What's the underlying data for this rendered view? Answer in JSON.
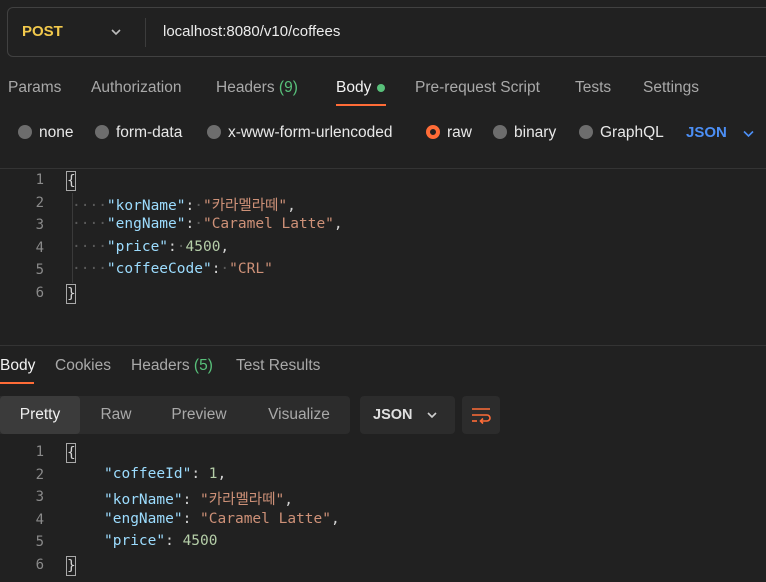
{
  "request": {
    "method": "POST",
    "url": "localhost:8080/v10/coffees"
  },
  "request_tabs": {
    "params": "Params",
    "authorization": "Authorization",
    "headers": "Headers",
    "headers_count": "(9)",
    "body": "Body",
    "pre_request_script": "Pre-request Script",
    "tests": "Tests",
    "settings": "Settings"
  },
  "body_types": {
    "none": "none",
    "form_data": "form-data",
    "x_www_form_urlencoded": "x-www-form-urlencoded",
    "raw": "raw",
    "binary": "binary",
    "graphql": "GraphQL",
    "selected": "raw",
    "format": "JSON"
  },
  "request_body": {
    "line_numbers": [
      "1",
      "2",
      "3",
      "4",
      "5",
      "6"
    ],
    "lines": [
      {
        "key": "\"korName\"",
        "value": "\"카라멜라떼\""
      },
      {
        "key": "\"engName\"",
        "value": "\"Caramel Latte\""
      },
      {
        "key": "\"price\"",
        "value": "4500"
      },
      {
        "key": "\"coffeeCode\"",
        "value": "\"CRL\""
      }
    ],
    "open_brace": "{",
    "close_brace": "}"
  },
  "response_tabs": {
    "body": "Body",
    "cookies": "Cookies",
    "headers": "Headers",
    "headers_count": "(5)",
    "test_results": "Test Results"
  },
  "response_view": {
    "pretty": "Pretty",
    "raw": "Raw",
    "preview": "Preview",
    "visualize": "Visualize",
    "selected": "Pretty",
    "format": "JSON"
  },
  "response_body": {
    "line_numbers": [
      "1",
      "2",
      "3",
      "4",
      "5",
      "6"
    ],
    "lines": [
      {
        "key": "\"coffeeId\"",
        "value": "1"
      },
      {
        "key": "\"korName\"",
        "value": "\"카라멜라떼\""
      },
      {
        "key": "\"engName\"",
        "value": "\"Caramel Latte\""
      },
      {
        "key": "\"price\"",
        "value": "4500"
      }
    ],
    "open_brace": "{",
    "close_brace": "}"
  },
  "colors": {
    "accent": "#ff6c37",
    "method": "#f2c94c",
    "json_link": "#4c8ff5",
    "count": "#58c07a",
    "background": "#212121"
  },
  "icons": {
    "method_chevron": "chevron-down-icon",
    "format_chevron": "chevron-down-icon",
    "wrap": "wrap-lines-icon"
  }
}
